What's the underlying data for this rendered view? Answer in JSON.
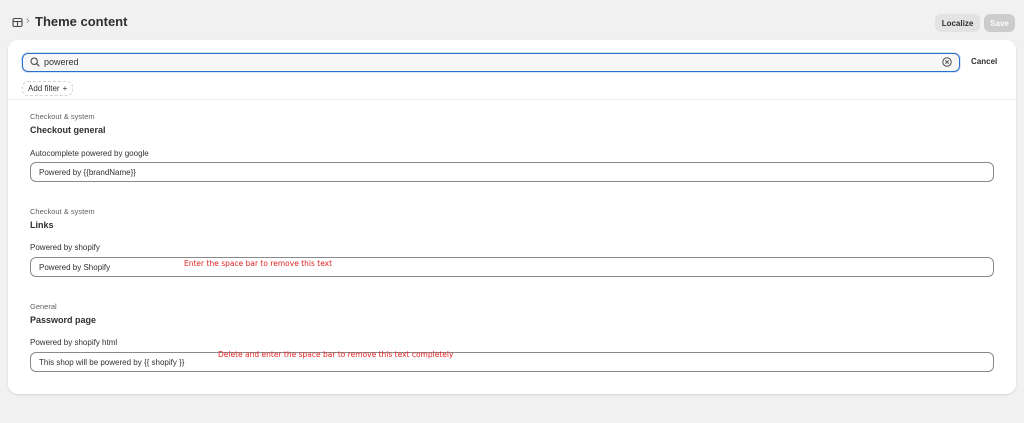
{
  "header": {
    "title": "Theme content",
    "localize_label": "Localize",
    "save_label": "Save"
  },
  "search": {
    "value": "powered",
    "cancel_label": "Cancel"
  },
  "filters": {
    "add_filter_label": "Add filter",
    "add_symbol": "+"
  },
  "sections": [
    {
      "category": "Checkout & system",
      "title": "Checkout general",
      "field_label": "Autocomplete powered by google",
      "field_value": "Powered by {{brandName}}",
      "annotation": ""
    },
    {
      "category": "Checkout & system",
      "title": "Links",
      "field_label": "Powered by shopify",
      "field_value": "Powered by Shopify",
      "annotation": "Enter the space bar to remove this text"
    },
    {
      "category": "General",
      "title": "Password page",
      "field_label": "Powered by shopify html",
      "field_value": "This shop will be powered by {{ shopify }}",
      "annotation": "Delete and enter the space bar to remove this text completely"
    }
  ],
  "colors": {
    "focus_border": "#2c6ecb",
    "annotation": "#e02424",
    "background": "#f1f1f1"
  },
  "icons": {
    "home": "store-icon",
    "search": "search-icon",
    "clear": "clear-circle-icon"
  }
}
